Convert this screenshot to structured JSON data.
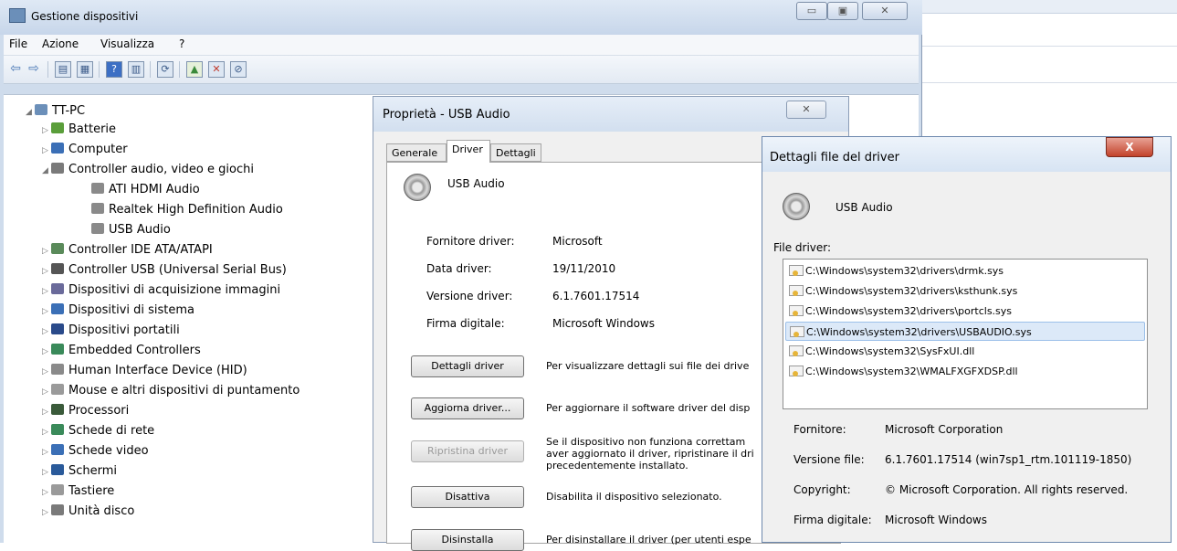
{
  "device_manager": {
    "title": "Gestione dispositivi",
    "caption_buttons": [
      "▭",
      "▣",
      "✕"
    ],
    "menu": [
      "File",
      "Azione",
      "Visualizza",
      "?"
    ],
    "tree_root": "TT-PC",
    "tree": [
      {
        "label": "Batterie",
        "color": "#5a9e3a"
      },
      {
        "label": "Computer",
        "color": "#3b6fb6"
      },
      {
        "label": "Controller audio, video e giochi",
        "color": "#7a7a7a"
      },
      {
        "label": "ATI HDMI Audio",
        "color": "#8a8a8a"
      },
      {
        "label": "Realtek High Definition Audio",
        "color": "#8a8a8a"
      },
      {
        "label": "USB Audio",
        "color": "#8a8a8a"
      },
      {
        "label": "Controller IDE ATA/ATAPI",
        "color": "#5a8a5a"
      },
      {
        "label": "Controller USB (Universal Serial Bus)",
        "color": "#555555"
      },
      {
        "label": "Dispositivi di acquisizione immagini",
        "color": "#6a6a9a"
      },
      {
        "label": "Dispositivi di sistema",
        "color": "#3b6fb6"
      },
      {
        "label": "Dispositivi portatili",
        "color": "#2a4a8a"
      },
      {
        "label": "Embedded Controllers",
        "color": "#3a8a5a"
      },
      {
        "label": "Human Interface Device (HID)",
        "color": "#8a8a8a"
      },
      {
        "label": "Mouse e altri dispositivi di puntamento",
        "color": "#9a9a9a"
      },
      {
        "label": "Processori",
        "color": "#3a5a3a"
      },
      {
        "label": "Schede di rete",
        "color": "#3a8a5a"
      },
      {
        "label": "Schede video",
        "color": "#3b6fb6"
      },
      {
        "label": "Schermi",
        "color": "#2a5a9a"
      },
      {
        "label": "Tastiere",
        "color": "#9a9a9a"
      },
      {
        "label": "Unità disco",
        "color": "#7a7a7a"
      }
    ]
  },
  "properties": {
    "title": "Proprietà - USB Audio",
    "close": "✕",
    "tabs": [
      "Generale",
      "Driver",
      "Dettagli"
    ],
    "device_name": "USB Audio",
    "fields": [
      {
        "label": "Fornitore driver:",
        "value": "Microsoft"
      },
      {
        "label": "Data driver:",
        "value": "19/11/2010"
      },
      {
        "label": "Versione driver:",
        "value": "6.1.7601.17514"
      },
      {
        "label": "Firma digitale:",
        "value": "Microsoft Windows"
      }
    ],
    "actions": [
      {
        "button": "Dettagli driver",
        "desc": "Per visualizzare dettagli sui file dei drive"
      },
      {
        "button": "Aggiorna driver...",
        "desc": "Per aggiornare il software driver del disp"
      },
      {
        "button": "Ripristina driver",
        "desc": "Se il dispositivo non funziona correttam\naver aggiornato il driver, ripristinare il dri\nprecedentemente installato."
      },
      {
        "button": "Disattiva",
        "desc": "Disabilita il dispositivo selezionato."
      },
      {
        "button": "Disinstalla",
        "desc": "Per disinstallare il driver (per utenti espe"
      }
    ]
  },
  "details": {
    "title": "Dettagli file del driver",
    "close": "X",
    "device_name": "USB Audio",
    "files_label": "File driver:",
    "files": [
      "C:\\Windows\\system32\\drivers\\drmk.sys",
      "C:\\Windows\\system32\\drivers\\ksthunk.sys",
      "C:\\Windows\\system32\\drivers\\portcls.sys",
      "C:\\Windows\\system32\\drivers\\USBAUDIO.sys",
      "C:\\Windows\\system32\\SysFxUI.dll",
      "C:\\Windows\\system32\\WMALFXGFXDSP.dll"
    ],
    "info": [
      {
        "label": "Fornitore:",
        "value": "Microsoft Corporation"
      },
      {
        "label": "Versione file:",
        "value": "6.1.7601.17514 (win7sp1_rtm.101119-1850)"
      },
      {
        "label": "Copyright:",
        "value": "© Microsoft Corporation. All rights reserved."
      },
      {
        "label": "Firma digitale:",
        "value": "Microsoft Windows"
      }
    ]
  }
}
